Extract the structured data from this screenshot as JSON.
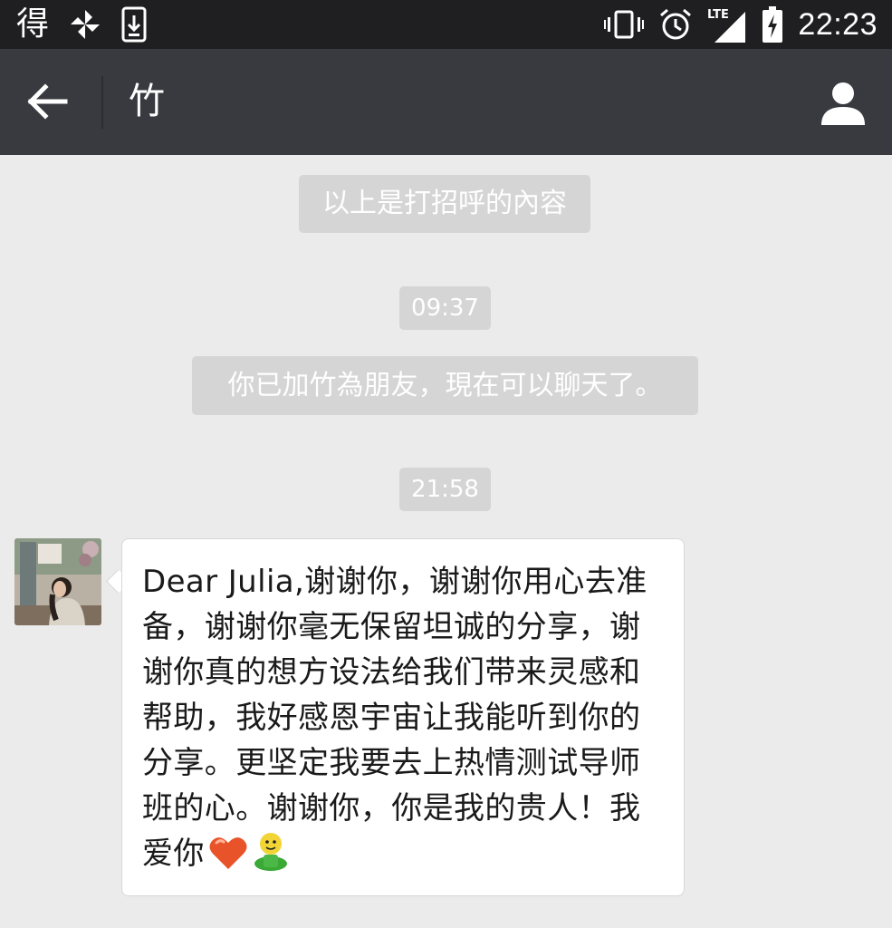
{
  "status_bar": {
    "left_char": "得",
    "time": "22:23",
    "network_label": "LTE"
  },
  "header": {
    "title": "竹"
  },
  "messages": {
    "system_greeting": "以上是打招呼的內容",
    "timestamp_1": "09:37",
    "system_friend_added": "你已加竹為朋友，現在可以聊天了。",
    "timestamp_2": "21:58",
    "incoming_text": "Dear Julia,谢谢你，谢谢你用心去准备，谢谢你毫无保留坦诚的分享，谢谢你真的想方设法给我们带来灵感和帮助，我好感恩宇宙让我能听到你的分享。更坚定我要去上热情测试导师班的心。谢谢你，你是我的贵人！我爱你",
    "incoming_emojis": [
      "heart-emoji",
      "smiley-figure-emoji"
    ]
  },
  "colors": {
    "status_bar_bg": "#1f1f21",
    "header_bg": "#393a3f",
    "chat_bg": "#ebebeb",
    "system_pill_bg": "#d5d5d5",
    "bubble_bg": "#ffffff"
  }
}
